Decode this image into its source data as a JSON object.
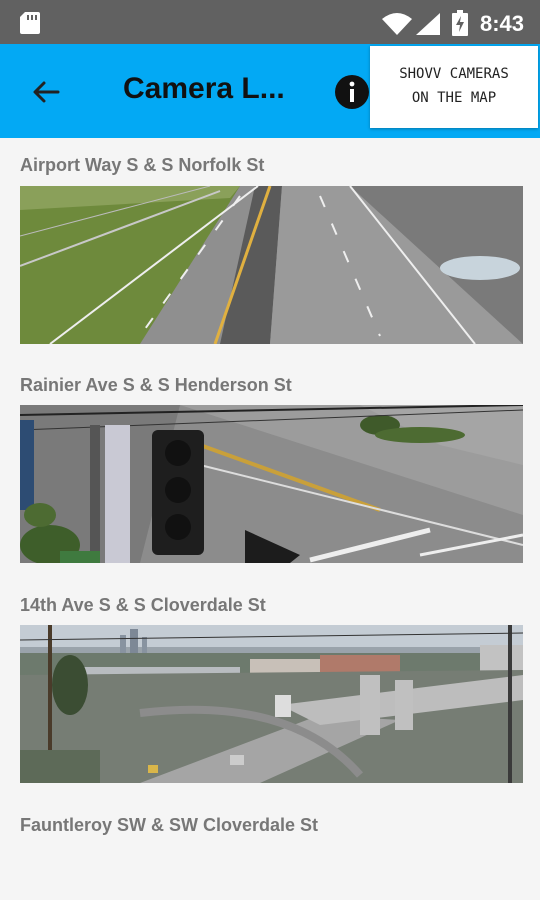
{
  "status_bar": {
    "time": "8:43"
  },
  "app_bar": {
    "title": "Camera L...",
    "back_icon": "arrow-left-icon",
    "info_icon": "info-icon"
  },
  "tooltip": {
    "line1": "SHOVV CAMERAS",
    "line2": "ON THE MAP"
  },
  "cameras": [
    {
      "name": "Airport Way S & S Norfolk St"
    },
    {
      "name": "Rainier Ave S & S Henderson St"
    },
    {
      "name": "14th Ave S & S Cloverdale St"
    },
    {
      "name": "Fauntleroy SW & SW Cloverdale St"
    }
  ],
  "colors": {
    "app_bar": "#03a9f4",
    "status_bar": "#616161",
    "title_text": "#777777"
  }
}
